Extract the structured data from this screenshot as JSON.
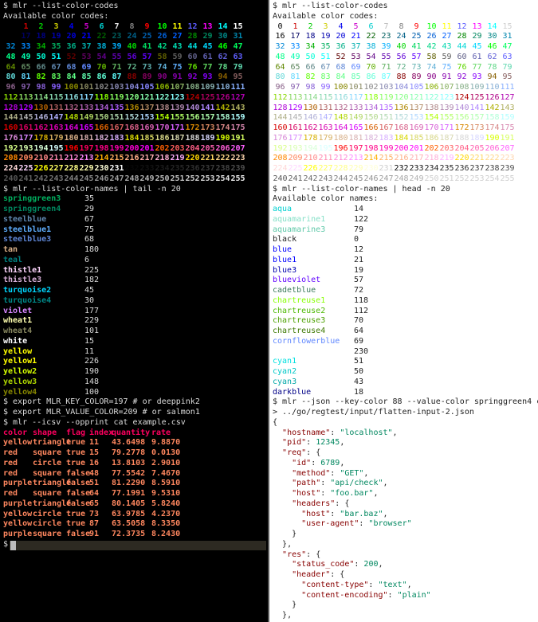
{
  "left": {
    "prompt1": "$ mlr --list-color-codes",
    "avail": "Available color codes:",
    "codes_prompt": "$ mlr --list-color-names | tail -n 20",
    "names": [
      {
        "n": "springgreen3",
        "v": "35",
        "c": "#00af5f"
      },
      {
        "n": "springgreen4",
        "v": "29",
        "c": "#00875f"
      },
      {
        "n": "steelblue",
        "v": "67",
        "c": "#5f87af"
      },
      {
        "n": "steelblue1",
        "v": "75",
        "c": "#5fafff"
      },
      {
        "n": "steelblue3",
        "v": "68",
        "c": "#5f87d7"
      },
      {
        "n": "tan",
        "v": "180",
        "c": "#d7af87"
      },
      {
        "n": "teal",
        "v": "6",
        "c": "#008080"
      },
      {
        "n": "thistle1",
        "v": "225",
        "c": "#ffd7ff"
      },
      {
        "n": "thistle3",
        "v": "182",
        "c": "#d7afd7"
      },
      {
        "n": "turquoise2",
        "v": "45",
        "c": "#00d7ff"
      },
      {
        "n": "turquoise4",
        "v": "30",
        "c": "#008787"
      },
      {
        "n": "violet",
        "v": "177",
        "c": "#d787ff"
      },
      {
        "n": "wheat1",
        "v": "229",
        "c": "#ffffaf"
      },
      {
        "n": "wheat4",
        "v": "101",
        "c": "#87875f"
      },
      {
        "n": "white",
        "v": "15",
        "c": "#ffffff"
      },
      {
        "n": "yellow",
        "v": "11",
        "c": "#ffff00"
      },
      {
        "n": "yellow1",
        "v": "226",
        "c": "#ffff00"
      },
      {
        "n": "yellow2",
        "v": "190",
        "c": "#d7ff00"
      },
      {
        "n": "yellow3",
        "v": "148",
        "c": "#afd700"
      },
      {
        "n": "yellow4",
        "v": "100",
        "c": "#878700"
      }
    ],
    "cmd1": "$ export MLR_KEY_COLOR=197 # or deeppink2",
    "cmd2": "$ export MLR_VALUE_COLOR=209 # or salmon1",
    "cmd3": "$ mlr --icsv --opprint cat example.csv",
    "csv_header": [
      "color",
      "shape",
      "flag",
      "index",
      "quantity",
      "rate"
    ],
    "csv_rows": [
      [
        "yellow",
        "triangle",
        "true",
        "11",
        "43.6498",
        "9.8870"
      ],
      [
        "red",
        "square",
        "true",
        "15",
        "79.2778",
        "0.0130"
      ],
      [
        "red",
        "circle",
        "true",
        "16",
        "13.8103",
        "2.9010"
      ],
      [
        "red",
        "square",
        "false",
        "48",
        "77.5542",
        "7.4670"
      ],
      [
        "purple",
        "triangle",
        "false",
        "51",
        "81.2290",
        "8.5910"
      ],
      [
        "red",
        "square",
        "false",
        "64",
        "77.1991",
        "9.5310"
      ],
      [
        "purple",
        "triangle",
        "false",
        "65",
        "80.1405",
        "5.8240"
      ],
      [
        "yellow",
        "circle",
        "true",
        "73",
        "63.9785",
        "4.2370"
      ],
      [
        "yellow",
        "circle",
        "true",
        "87",
        "63.5058",
        "8.3350"
      ],
      [
        "purple",
        "square",
        "false",
        "91",
        "72.3735",
        "8.2430"
      ]
    ],
    "prompt_final": "$",
    "key_color": "#ff005f",
    "value_color": "#ff875f"
  },
  "right": {
    "prompt1": "$ mlr --list-color-codes",
    "avail": "Available color codes:",
    "names_prompt": "$ mlr --list-color-names | head -n 20",
    "avail_names": "Available color names:",
    "names": [
      {
        "n": "aqua",
        "v": "14",
        "c": "#00d0d0"
      },
      {
        "n": "aquamarine1",
        "v": "122",
        "c": "#87e0c8"
      },
      {
        "n": "aquamarine3",
        "v": "79",
        "c": "#5fc8a8"
      },
      {
        "n": "black",
        "v": "0",
        "c": "#222222"
      },
      {
        "n": "blue",
        "v": "12",
        "c": "#0000ff"
      },
      {
        "n": "blue1",
        "v": "21",
        "c": "#0000ff"
      },
      {
        "n": "blue3",
        "v": "19",
        "c": "#0000af"
      },
      {
        "n": "blueviolet",
        "v": "57",
        "c": "#5f00ff"
      },
      {
        "n": "cadetblue",
        "v": "72",
        "c": "#3a7a5a"
      },
      {
        "n": "chartreuse1",
        "v": "118",
        "c": "#87ff00"
      },
      {
        "n": "chartreuse2",
        "v": "112",
        "c": "#4cb800"
      },
      {
        "n": "chartreuse3",
        "v": "70",
        "c": "#4ca000"
      },
      {
        "n": "chartreuse4",
        "v": "64",
        "c": "#3c7800"
      },
      {
        "n": "cornflowerblue",
        "v": "69",
        "c": "#5f87ff"
      },
      {
        "n": "",
        "v": "230",
        "c": "#222222"
      },
      {
        "n": "cyan1",
        "v": "51",
        "c": "#00e0e0"
      },
      {
        "n": "cyan2",
        "v": "50",
        "c": "#00c8c8"
      },
      {
        "n": "cyan3",
        "v": "43",
        "c": "#00a8a8"
      },
      {
        "n": "darkblue",
        "v": "18",
        "c": "#000087"
      }
    ],
    "json_cmd1": "$ mlr --json --key-color 88 --value-color springgreen4 cat \\",
    "json_cmd2": "> ../go/regtest/input/flatten-input-2.json",
    "key_color": "#870000",
    "value_color": "#00875f",
    "json_lines": [
      {
        "i": 0,
        "p": "{"
      },
      {
        "i": 1,
        "k": "\"hostname\"",
        "s": ": ",
        "v": "\"localhost\"",
        "e": ","
      },
      {
        "i": 1,
        "k": "\"pid\"",
        "s": ": ",
        "v": "12345",
        "e": ","
      },
      {
        "i": 1,
        "k": "\"req\"",
        "s": ": {"
      },
      {
        "i": 2,
        "k": "\"id\"",
        "s": ": ",
        "v": "6789",
        "e": ","
      },
      {
        "i": 2,
        "k": "\"method\"",
        "s": ": ",
        "v": "\"GET\"",
        "e": ","
      },
      {
        "i": 2,
        "k": "\"path\"",
        "s": ": ",
        "v": "\"api/check\"",
        "e": ","
      },
      {
        "i": 2,
        "k": "\"host\"",
        "s": ": ",
        "v": "\"foo.bar\"",
        "e": ","
      },
      {
        "i": 2,
        "k": "\"headers\"",
        "s": ": {"
      },
      {
        "i": 3,
        "k": "\"host\"",
        "s": ": ",
        "v": "\"bar.baz\"",
        "e": ","
      },
      {
        "i": 3,
        "k": "\"user-agent\"",
        "s": ": ",
        "v": "\"browser\""
      },
      {
        "i": 2,
        "p": "}"
      },
      {
        "i": 1,
        "p": "},"
      },
      {
        "i": 1,
        "k": "\"res\"",
        "s": ": {"
      },
      {
        "i": 2,
        "k": "\"status_code\"",
        "s": ": ",
        "v": "200",
        "e": ","
      },
      {
        "i": 2,
        "k": "\"header\"",
        "s": ": {"
      },
      {
        "i": 3,
        "k": "\"content-type\"",
        "s": ": ",
        "v": "\"text\"",
        "e": ","
      },
      {
        "i": 3,
        "k": "\"content-encoding\"",
        "s": ": ",
        "v": "\"plain\""
      },
      {
        "i": 2,
        "p": "}"
      },
      {
        "i": 1,
        "p": "},"
      }
    ]
  }
}
